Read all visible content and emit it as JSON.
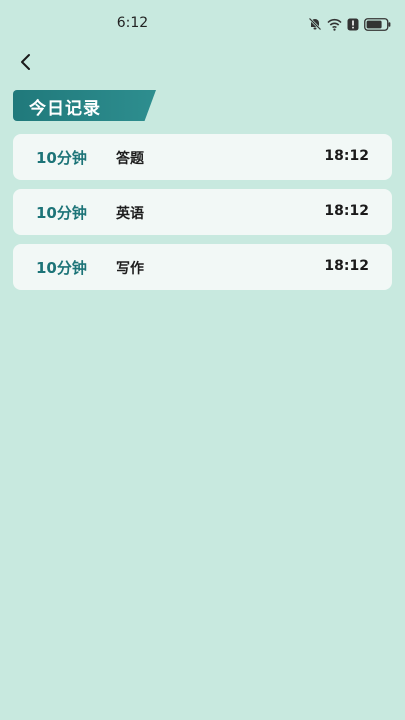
{
  "status_bar": {
    "time": "6:12",
    "icons": [
      "mute-bell-icon",
      "wifi-icon",
      "alert-icon",
      "battery-icon"
    ]
  },
  "nav": {
    "back_icon": "chevron-left-icon"
  },
  "section": {
    "title": "今日记录"
  },
  "records": [
    {
      "duration": "10分钟",
      "subject": "答题",
      "time": "18:12"
    },
    {
      "duration": "10分钟",
      "subject": "英语",
      "time": "18:12"
    },
    {
      "duration": "10分钟",
      "subject": "写作",
      "time": "18:12"
    }
  ],
  "colors": {
    "background": "#c8e9df",
    "accent": "#20797b",
    "card": "#f2f8f6"
  }
}
